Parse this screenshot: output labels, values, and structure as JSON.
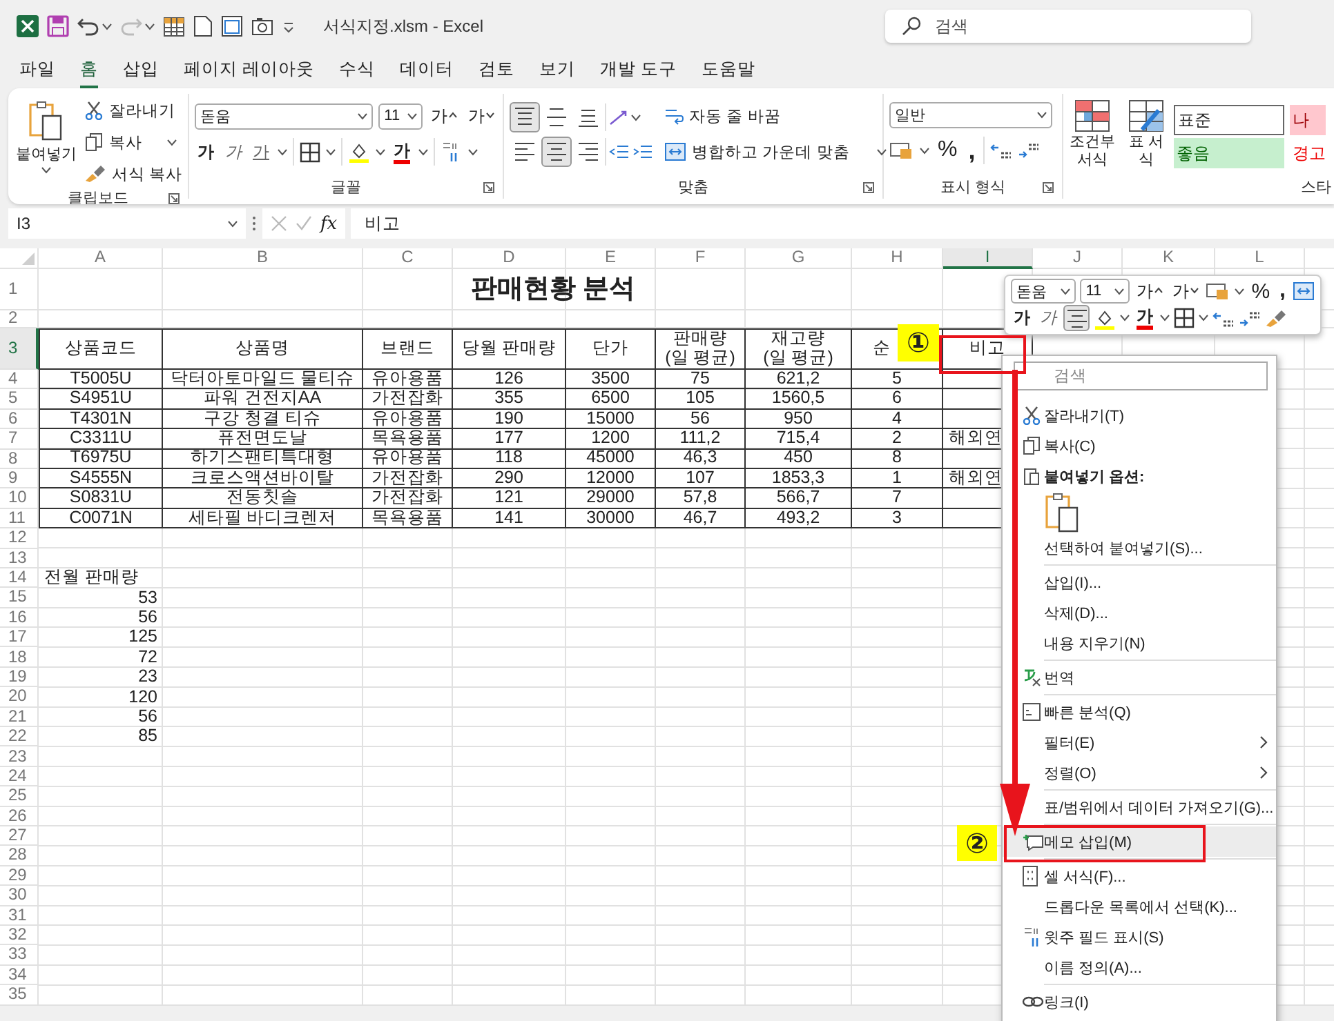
{
  "title_bar": {
    "title": "서식지정.xlsm - Excel",
    "search_placeholder": "검색"
  },
  "menu_tabs": [
    {
      "label": "파일",
      "selected": false
    },
    {
      "label": "홈",
      "selected": true
    },
    {
      "label": "삽입",
      "selected": false
    },
    {
      "label": "페이지 레이아웃",
      "selected": false
    },
    {
      "label": "수식",
      "selected": false
    },
    {
      "label": "데이터",
      "selected": false
    },
    {
      "label": "검토",
      "selected": false
    },
    {
      "label": "보기",
      "selected": false
    },
    {
      "label": "개발 도구",
      "selected": false
    },
    {
      "label": "도움말",
      "selected": false
    }
  ],
  "ribbon": {
    "clipboard": {
      "paste": "붙여넣기",
      "cut": "잘라내기",
      "copy": "복사",
      "format_painter": "서식 복사",
      "label": "클립보드"
    },
    "font": {
      "font_name": "돋움",
      "font_size": "11",
      "grow": "가",
      "shrink": "가",
      "bold": "가",
      "italic": "가",
      "underline": "가",
      "font_color": "가",
      "label": "글꼴"
    },
    "alignment": {
      "align_buttons": [
        {
          "kind": "top",
          "selected": true
        },
        {
          "kind": "middle",
          "selected": false
        },
        {
          "kind": "bottom",
          "selected": false
        },
        {
          "kind": "left",
          "selected": false
        },
        {
          "kind": "center",
          "selected": true
        },
        {
          "kind": "right",
          "selected": false
        }
      ],
      "wrap_text": "자동 줄 바꿈",
      "merge_center": "병합하고 가운데 맞춤",
      "label": "맞춤"
    },
    "number": {
      "format": "일반",
      "percent": "%",
      "comma": ",",
      "label": "표시 형식"
    },
    "styles": {
      "conditional_formatting": "조건부 서식",
      "format_as_table": "표 서식",
      "cell_styles": [
        {
          "label": "표준",
          "kind": "normal"
        },
        {
          "label": "나",
          "kind": "bad"
        },
        {
          "label": "좋음",
          "kind": "good"
        },
        {
          "label": "경고",
          "kind": "warning"
        }
      ],
      "label": "스타"
    }
  },
  "formula_bar": {
    "name_box": "I3",
    "fx": "fx",
    "value": "비고"
  },
  "sheet": {
    "columns": [
      {
        "label": "A",
        "selected": false
      },
      {
        "label": "B",
        "selected": false
      },
      {
        "label": "C",
        "selected": false
      },
      {
        "label": "D",
        "selected": false
      },
      {
        "label": "E",
        "selected": false
      },
      {
        "label": "F",
        "selected": false
      },
      {
        "label": "G",
        "selected": false
      },
      {
        "label": "H",
        "selected": false
      },
      {
        "label": "I",
        "selected": true
      },
      {
        "label": "J",
        "selected": false
      },
      {
        "label": "K",
        "selected": false
      },
      {
        "label": "L",
        "selected": false
      }
    ],
    "row_numbers": [
      {
        "label": "1",
        "selected": false
      },
      {
        "label": "2",
        "selected": false
      },
      {
        "label": "3",
        "selected": true
      },
      {
        "label": "4",
        "selected": false
      },
      {
        "label": "5",
        "selected": false
      },
      {
        "label": "6",
        "selected": false
      },
      {
        "label": "7",
        "selected": false
      },
      {
        "label": "8",
        "selected": false
      },
      {
        "label": "9",
        "selected": false
      },
      {
        "label": "10",
        "selected": false
      },
      {
        "label": "11",
        "selected": false
      },
      {
        "label": "12",
        "selected": false
      },
      {
        "label": "13",
        "selected": false
      },
      {
        "label": "14",
        "selected": false
      },
      {
        "label": "15",
        "selected": false
      },
      {
        "label": "16",
        "selected": false
      },
      {
        "label": "17",
        "selected": false
      },
      {
        "label": "18",
        "selected": false
      },
      {
        "label": "19",
        "selected": false
      },
      {
        "label": "20",
        "selected": false
      },
      {
        "label": "21",
        "selected": false
      },
      {
        "label": "22",
        "selected": false
      },
      {
        "label": "23",
        "selected": false
      },
      {
        "label": "24",
        "selected": false
      },
      {
        "label": "25",
        "selected": false
      },
      {
        "label": "26",
        "selected": false
      },
      {
        "label": "27",
        "selected": false
      },
      {
        "label": "28",
        "selected": false
      },
      {
        "label": "29",
        "selected": false
      },
      {
        "label": "30",
        "selected": false
      },
      {
        "label": "31",
        "selected": false
      },
      {
        "label": "32",
        "selected": false
      },
      {
        "label": "33",
        "selected": false
      },
      {
        "label": "34",
        "selected": false
      },
      {
        "label": "35",
        "selected": false
      }
    ],
    "title": "판매현황 분석",
    "headers": [
      "상품코드",
      "상품명",
      "브랜드",
      "당월 판매량",
      "단가",
      "판매량\n(일 평균)",
      "재고량\n(일 평균)",
      "순",
      "비고"
    ],
    "records": [
      [
        "T5005U",
        "닥터아토마일드 물티슈",
        "유아용품",
        "126",
        "3500",
        "75",
        "621,2",
        "5"
      ],
      [
        "S4951U",
        "파워 건전지AA",
        "가전잡화",
        "355",
        "6500",
        "105",
        "1560,5",
        "6"
      ],
      [
        "T4301N",
        "구강 청결 티슈",
        "유아용품",
        "190",
        "15000",
        "56",
        "950",
        "4"
      ],
      [
        "C3311U",
        "퓨전면도날",
        "목욕용품",
        "177",
        "1200",
        "111,2",
        "715,4",
        "2",
        "해외연"
      ],
      [
        "T6975U",
        "하기스팬티특대형",
        "유아용품",
        "118",
        "45000",
        "46,3",
        "450",
        "8"
      ],
      [
        "S4555N",
        "크로스액션바이탈",
        "가전잡화",
        "290",
        "12000",
        "107",
        "1853,3",
        "1",
        "해외연"
      ],
      [
        "S0831U",
        "전동칫솔",
        "가전잡화",
        "121",
        "29000",
        "57,8",
        "566,7",
        "7"
      ],
      [
        "C0071N",
        "세타필 바디크렌저",
        "목욕용품",
        "141",
        "30000",
        "46,7",
        "493,2",
        "3"
      ]
    ],
    "prev_month": {
      "label": "전월 판매량",
      "values": [
        "53",
        "56",
        "125",
        "72",
        "23",
        "120",
        "56",
        "85"
      ]
    }
  },
  "mini_toolbar": {
    "font_name": "돋움",
    "font_size": "11",
    "grow": "가",
    "shrink": "가",
    "percent": "%",
    "comma": ",",
    "bold": "가",
    "italic": "가",
    "center_selected": true,
    "font_color": "가"
  },
  "context_menu": {
    "search_placeholder": "검색",
    "groups": [
      {
        "items": [
          {
            "kind": "command",
            "label": "잘라내기(T)",
            "selected": false
          },
          {
            "kind": "command",
            "label": "복사(C)",
            "selected": false
          },
          {
            "kind": "heading",
            "label": "붙여넣기 옵션:",
            "selected": false
          },
          {
            "kind": "paste_icons",
            "selected": false
          },
          {
            "kind": "command",
            "label": "선택하여 붙여넣기(S)...",
            "selected": false
          }
        ]
      },
      {
        "items": [
          {
            "kind": "command",
            "label": "삽입(I)...",
            "selected": false
          },
          {
            "kind": "command",
            "label": "삭제(D)...",
            "selected": false
          },
          {
            "kind": "command",
            "label": "내용 지우기(N)",
            "selected": false
          }
        ]
      },
      {
        "items": [
          {
            "kind": "command",
            "label": "번역",
            "selected": false
          }
        ]
      },
      {
        "items": [
          {
            "kind": "command",
            "label": "빠른 분석(Q)",
            "selected": false
          },
          {
            "kind": "submenu",
            "label": "필터(E)",
            "selected": false
          },
          {
            "kind": "submenu",
            "label": "정렬(O)",
            "selected": false
          }
        ]
      },
      {
        "items": [
          {
            "kind": "command",
            "label": "표/범위에서 데이터 가져오기(G)...",
            "selected": false
          }
        ]
      },
      {
        "items": [
          {
            "kind": "command",
            "label": "메모 삽입(M)",
            "selected": true
          }
        ]
      },
      {
        "items": [
          {
            "kind": "command",
            "label": "셀 서식(F)...",
            "selected": false
          },
          {
            "kind": "command",
            "label": "드롭다운 목록에서 선택(K)...",
            "selected": false
          },
          {
            "kind": "command",
            "label": "윗주 필드 표시(S)",
            "selected": false
          },
          {
            "kind": "command",
            "label": "이름 정의(A)...",
            "selected": false
          }
        ]
      },
      {
        "items": [
          {
            "kind": "command",
            "label": "링크(I)",
            "selected": false
          }
        ]
      }
    ]
  },
  "annotations": [
    {
      "label": "①"
    },
    {
      "label": "②"
    }
  ]
}
